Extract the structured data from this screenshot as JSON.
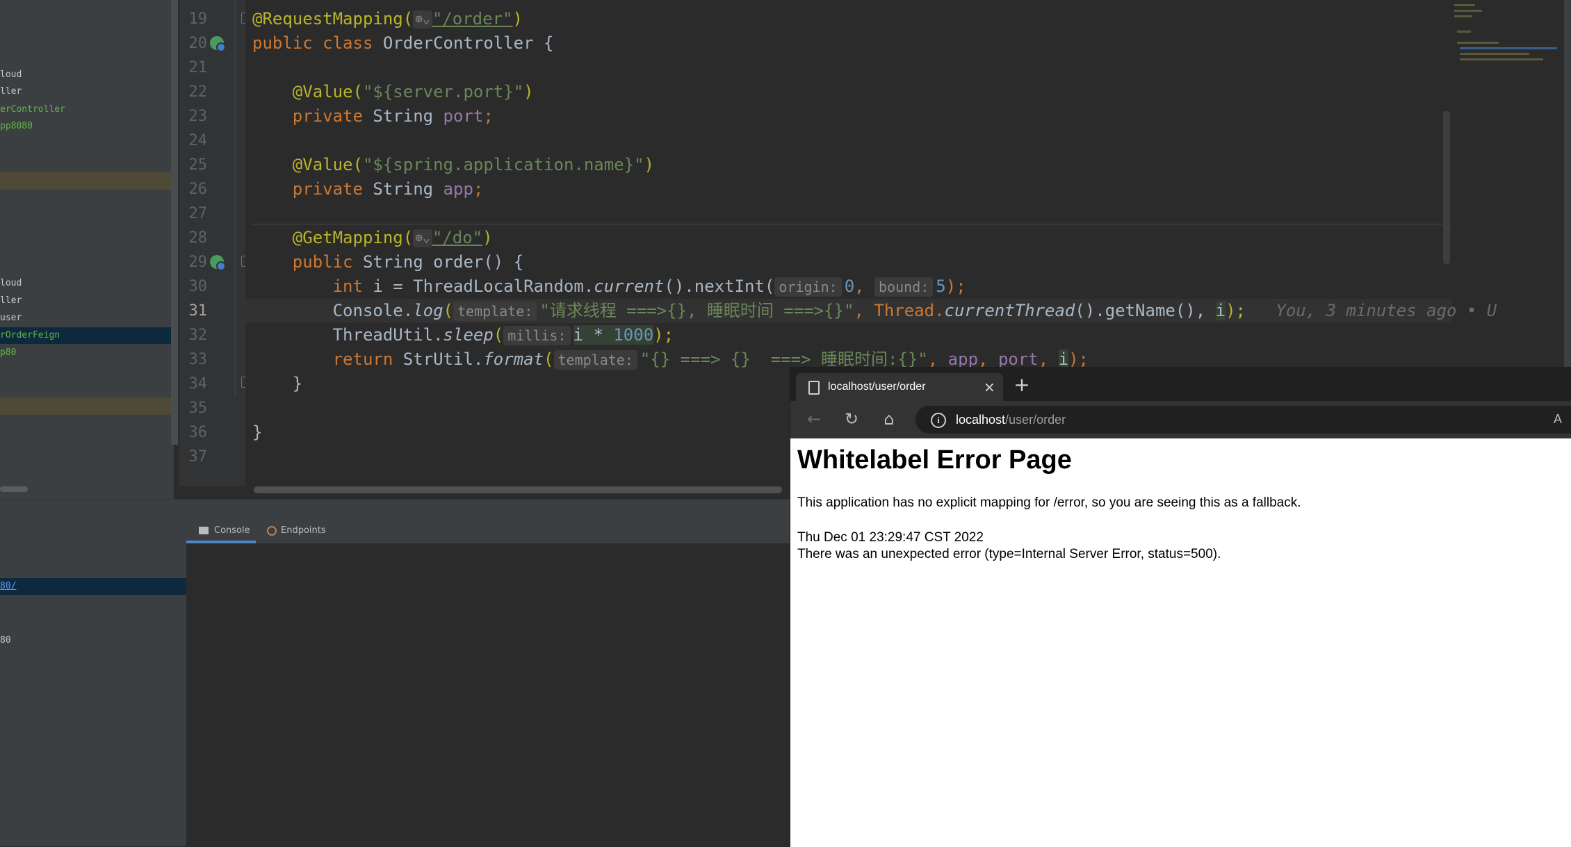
{
  "project_tree": {
    "items": [
      {
        "label": "loud",
        "style": "normal"
      },
      {
        "label": "ller",
        "style": "normal"
      },
      {
        "label": "erController",
        "style": "green"
      },
      {
        "label": "pp8080",
        "style": "green"
      },
      {
        "label": "loud",
        "style": "normal"
      },
      {
        "label": "ller",
        "style": "normal"
      },
      {
        "label": "user",
        "style": "normal"
      },
      {
        "label": "rOrderFeign",
        "style": "selected"
      },
      {
        "label": "p80",
        "style": "green"
      }
    ]
  },
  "editor": {
    "line_numbers": [
      "19",
      "20",
      "21",
      "22",
      "23",
      "24",
      "25",
      "26",
      "27",
      "28",
      "29",
      "30",
      "31",
      "32",
      "33",
      "34",
      "35",
      "36",
      "37"
    ],
    "current_line": "31",
    "code": {
      "l19_ann": "@RequestMapping(",
      "l19_hint": "⊕⌄",
      "l19_str": "\"/order\"",
      "l19_close": ")",
      "l20_kw": "public class ",
      "l20_rest": "OrderController {",
      "l22_ann": "@Value(",
      "l22_str": "\"${server.port}\"",
      "l22_close": ")",
      "l23_kw": "private ",
      "l23_type": "String ",
      "l23_field": "port",
      "l23_end": ";",
      "l25_ann": "@Value(",
      "l25_str": "\"${spring.application.name}\"",
      "l25_close": ")",
      "l26_kw": "private ",
      "l26_type": "String ",
      "l26_field": "app",
      "l26_end": ";",
      "l28_ann": "@GetMapping(",
      "l28_hint": "⊕⌄",
      "l28_str": "\"/do\"",
      "l28_close": ")",
      "l29_kw": "public ",
      "l29_rest": "String order() {",
      "l30_kw": "int ",
      "l30_a": "i = ThreadLocalRandom.",
      "l30_current": "current",
      "l30_b": "().nextInt(",
      "l30_hint1": "origin:",
      "l30_n1": "0",
      "l30_comma": ", ",
      "l30_hint2": "bound:",
      "l30_n2": "5",
      "l30_end": ");",
      "l31_a": "Console.",
      "l31_log": "log",
      "l31_paren": "(",
      "l31_hint": "template:",
      "l31_str": "\"请求线程 ===>{}, 睡眠时间 ===>{}\"",
      "l31_b": ", Thread.",
      "l31_ct": "currentThread",
      "l31_c": "().getName(), ",
      "l31_i": "i",
      "l31_end": ");",
      "l31_blame": "You, 3 minutes ago • U",
      "l32_a": "ThreadUtil.",
      "l32_sleep": "sleep",
      "l32_paren": "(",
      "l32_hint": "millis:",
      "l32_expr": "i * ",
      "l32_num": "1000",
      "l32_end": ");",
      "l33_kw": "return ",
      "l33_a": "StrUtil.",
      "l33_fmt": "format",
      "l33_paren": "(",
      "l33_hint": "template:",
      "l33_str": "\"{} ===> {}  ===> 睡眠时间:{}\"",
      "l33_c1": ", ",
      "l33_app": "app",
      "l33_c2": ", ",
      "l33_port": "port",
      "l33_c3": ", ",
      "l33_i": "i",
      "l33_end": ");",
      "l34": "}",
      "l36": "}"
    }
  },
  "tool_window": {
    "tabs": [
      {
        "label": "Console",
        "icon": "console-icon"
      },
      {
        "label": "Endpoints",
        "icon": "endpoints-icon"
      }
    ],
    "run_items": [
      "80/",
      "80"
    ]
  },
  "browser": {
    "tab_title": "localhost/user/order",
    "tab_close": "×",
    "new_tab": "+",
    "address_host": "localhost",
    "address_path": "/user/order",
    "reader": "A",
    "page": {
      "title": "Whitelabel Error Page",
      "description": "This application has no explicit mapping for /error, so you are seeing this as a fallback.",
      "timestamp": "Thu Dec 01 23:29:47 CST 2022",
      "detail": "There was an unexpected error (type=Internal Server Error, status=500)."
    }
  },
  "colors": {
    "ide_bg": "#2b2b2b",
    "panel_bg": "#3c3f41",
    "keyword": "#cc7832",
    "annotation": "#bbb529",
    "string": "#6a8759",
    "number": "#6897bb",
    "field": "#9876aa"
  }
}
